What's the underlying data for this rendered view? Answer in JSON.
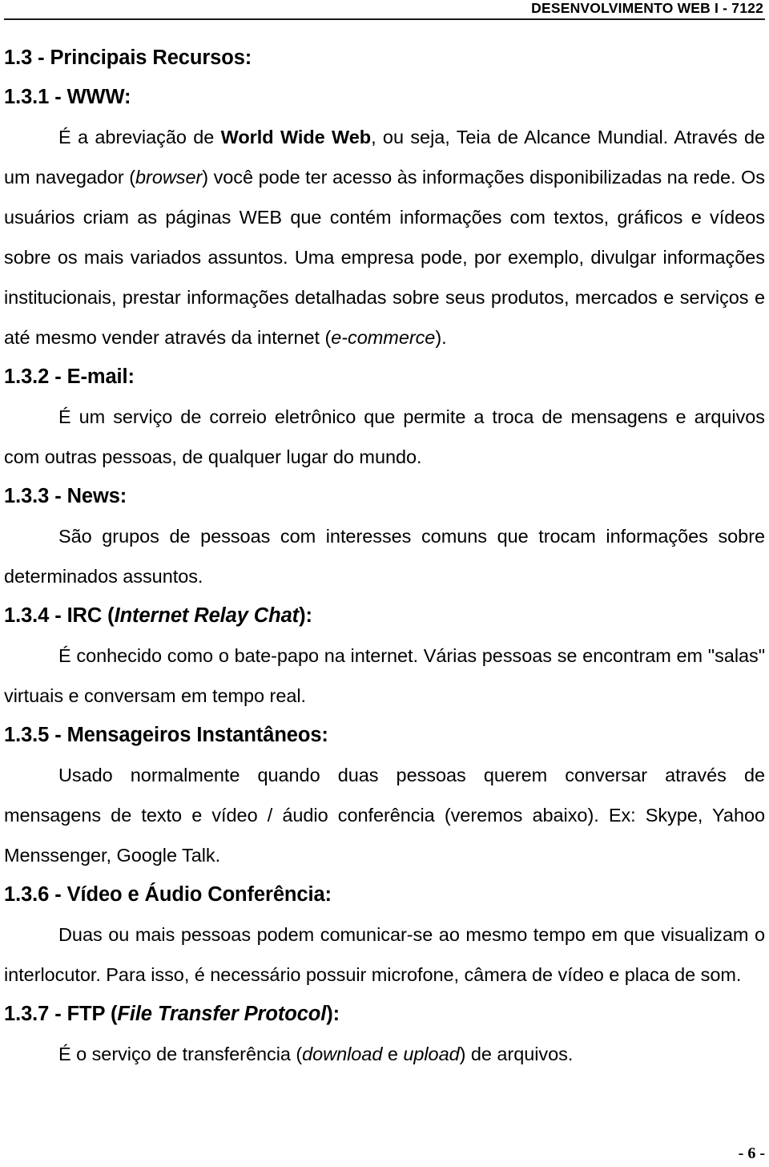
{
  "header": {
    "running_title": "DESENVOLVIMENTO WEB I - 7122"
  },
  "footer": {
    "page_number": "- 6 -"
  },
  "sections": {
    "main_heading": "1.3 - Principais Recursos:",
    "www": {
      "heading": "1.3.1 - WWW:",
      "body_part_1": "É a abreviação de ",
      "body_bold_1": "World Wide Web",
      "body_part_2": ", ou seja, Teia de Alcance Mundial. Através de um navegador (",
      "body_italic_1": "browser",
      "body_part_3": ") você pode ter acesso às informações disponibilizadas na rede. Os usuários criam as páginas WEB que contém informações com textos, gráficos e vídeos sobre os mais variados assuntos. Uma empresa pode, por exemplo, divulgar informações institucionais, prestar informações detalhadas sobre seus produtos, mercados e serviços e até mesmo vender através da internet (",
      "body_italic_2": "e-commerce",
      "body_part_4": ")."
    },
    "email": {
      "heading": "1.3.2 - E-mail:",
      "body": "É um serviço de correio eletrônico que permite a troca de mensagens e arquivos com outras pessoas, de qualquer lugar do mundo."
    },
    "news": {
      "heading": "1.3.3 - News:",
      "body": "São grupos de pessoas com interesses comuns que trocam informações sobre determinados assuntos."
    },
    "irc": {
      "heading_prefix": "1.3.4 - IRC (",
      "heading_em": "Internet Relay Chat",
      "heading_suffix": "):",
      "body": "É conhecido como o bate-papo na internet. Várias pessoas se encontram em \"salas\" virtuais e conversam em tempo real."
    },
    "instant_messengers": {
      "heading": "1.3.5 - Mensageiros Instantâneos:",
      "body": "Usado normalmente quando duas pessoas querem conversar através de mensagens de texto e vídeo / áudio conferência (veremos abaixo). Ex: Skype, Yahoo Menssenger, Google Talk."
    },
    "video_audio": {
      "heading": "1.3.6 - Vídeo e Áudio Conferência:",
      "body": "Duas ou mais pessoas podem comunicar-se ao mesmo tempo em que visualizam o interlocutor. Para isso, é necessário possuir microfone, câmera de vídeo e placa de som."
    },
    "ftp": {
      "heading_prefix": "1.3.7 - FTP (",
      "heading_em": "File Transfer Protocol",
      "heading_suffix": "):",
      "body_part_1": "É o serviço de transferência (",
      "body_italic_1": "download",
      "body_part_2": " e ",
      "body_italic_2": "upload",
      "body_part_3": ") de arquivos."
    }
  }
}
